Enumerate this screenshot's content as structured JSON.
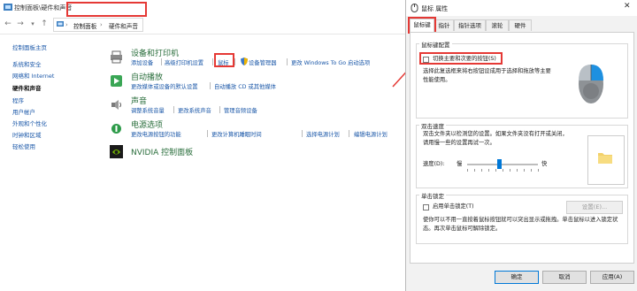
{
  "control_panel": {
    "title": "控制面板\\硬件和声音",
    "breadcrumb": [
      "控制面板",
      "硬件和声音"
    ],
    "sidebar": [
      {
        "label": "控制面板主页",
        "active": false
      },
      {
        "label": "系统和安全",
        "active": false
      },
      {
        "label": "网络和 Internet",
        "active": false
      },
      {
        "label": "硬件和声音",
        "active": true
      },
      {
        "label": "程序",
        "active": false
      },
      {
        "label": "用户帐户",
        "active": false
      },
      {
        "label": "外观和个性化",
        "active": false
      },
      {
        "label": "时钟和区域",
        "active": false
      },
      {
        "label": "轻松使用",
        "active": false
      }
    ],
    "sections": [
      {
        "title": "设备和打印机",
        "icon": "printer-icon",
        "links": [
          "添加设备",
          "高级打印机设置",
          "鼠标",
          "设备管理器",
          "更改 Windows To Go 启动选项"
        ]
      },
      {
        "title": "自动播放",
        "icon": "autoplay-icon",
        "links": [
          "更改媒体或设备的默认设置",
          "自动播放 CD 或其他媒体"
        ]
      },
      {
        "title": "声音",
        "icon": "speaker-icon",
        "links": [
          "调整系统音量",
          "更改系统声音",
          "管理音频设备"
        ]
      },
      {
        "title": "电源选项",
        "icon": "power-icon",
        "links": [
          "更改电源按钮的功能",
          "更改计算机睡眠时间",
          "选择电源计划",
          "编辑电源计划"
        ]
      },
      {
        "title": "NVIDIA 控制面板",
        "icon": "nvidia-icon",
        "links": []
      }
    ]
  },
  "dialog": {
    "title": "鼠标 属性",
    "tabs": [
      "鼠标键",
      "指针",
      "指针选项",
      "滚轮",
      "硬件"
    ],
    "active_tab": "鼠标键",
    "button_config": {
      "group_label": "鼠标键配置",
      "checkbox_label": "切换主要和次要的按钮(S)",
      "checked": false,
      "description": "选择此复选框来将右按钮设成用于选择和拖放等主要性能使用。"
    },
    "double_click": {
      "group_label": "双击速度",
      "description": "双击文件夹以检测您的设置。如果文件夹没有打开或关闭，请用慢一些的设置再试一次。",
      "speed_label": "速度(D):",
      "slow": "慢",
      "fast": "快",
      "speed_fraction": 0.45
    },
    "click_lock": {
      "group_label": "单击锁定",
      "checkbox_label": "启用单击锁定(T)",
      "checked": false,
      "settings_button": "设置(E)...",
      "description": "使你可以不用一直按着鼠标按钮就可以突出显示或拖拽。单击鼠标以进入锁定状态。再次单击鼠标可解除锁定。"
    },
    "buttons": {
      "ok": "确定",
      "cancel": "取消",
      "apply": "应用(A)"
    }
  },
  "colors": {
    "annotation": "#e53935",
    "link": "#1a57a8",
    "section_title": "#2a6e3c"
  }
}
